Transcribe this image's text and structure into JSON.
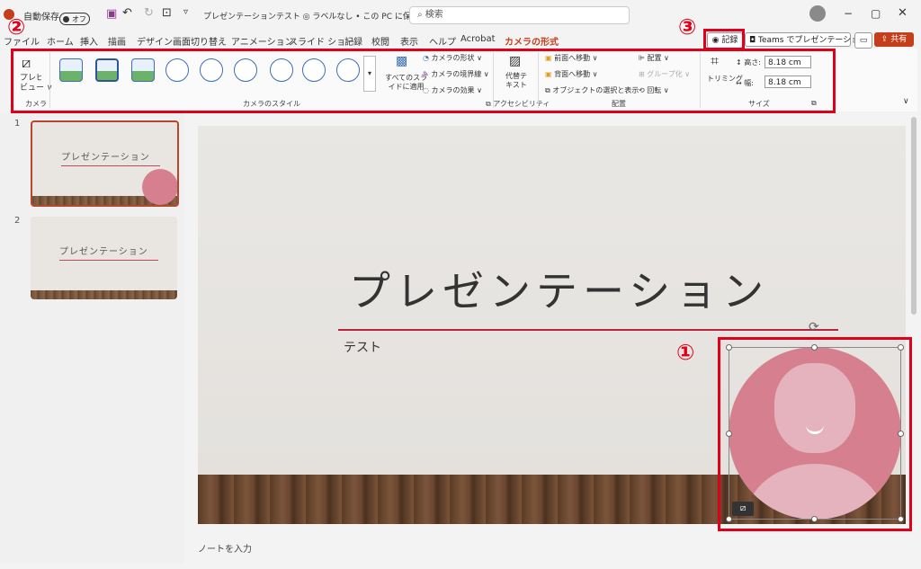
{
  "titlebar": {
    "autosave_label": "自動保存",
    "autosave_state": "オフ",
    "doc_info": "プレゼンテーションテスト ◎ ラベルなし • この PC に保存済み ∨",
    "search_placeholder": "検索"
  },
  "menu": {
    "items": [
      "ファイル",
      "ホーム",
      "挿入",
      "描画",
      "デザイン",
      "画面切り替え",
      "アニメーション",
      "スライド ショー",
      "記録",
      "校閲",
      "表示",
      "ヘルプ",
      "Acrobat",
      "カメラの形式"
    ],
    "active_index": 13,
    "record_button": "記録",
    "teams_button": "Teams でプレゼンテーション",
    "share_button": "共有"
  },
  "ribbon": {
    "preview_label": "プレビュー",
    "preview_sub": "ビュー ∨",
    "camera_group": "カメラ",
    "apply_all": "すべてのスライドに適用",
    "apply_all_2": "イドに適用",
    "apply_all_1": "すべてのスラ",
    "camera_shape": "カメラの形状 ∨",
    "camera_border": "カメラの境界線 ∨",
    "camera_effect": "カメラの効果 ∨",
    "style_group": "カメラのスタイル",
    "alt_text_1": "代替テ",
    "alt_text_2": "キスト",
    "accessibility_group": "アクセシビリティ",
    "bring_forward": "前面へ移動",
    "send_backward": "背面へ移動",
    "selection_pane": "オブジェクトの選択と表示",
    "align": "配置 ∨",
    "group": "グループ化 ∨",
    "rotate": "回転 ∨",
    "arrange_group": "配置",
    "trim": "トリミング",
    "height_label": "高さ:",
    "height_value": "8.18 cm",
    "width_label": "幅:",
    "width_value": "8.18 cm",
    "size_group": "サイズ"
  },
  "callouts": {
    "c1": "①",
    "c2": "②",
    "c3": "③"
  },
  "slides": {
    "thumb1_title": "プレゼンテーション",
    "thumb2_title": "プレゼンテーション",
    "num1": "1",
    "num2": "2"
  },
  "slide": {
    "title": "プレゼンテーション",
    "subtitle": "テスト"
  },
  "notes_placeholder": "ノートを入力",
  "colors": {
    "accent": "#c43e1c",
    "highlight": "#e0001a",
    "avatar": "#d6808f"
  }
}
